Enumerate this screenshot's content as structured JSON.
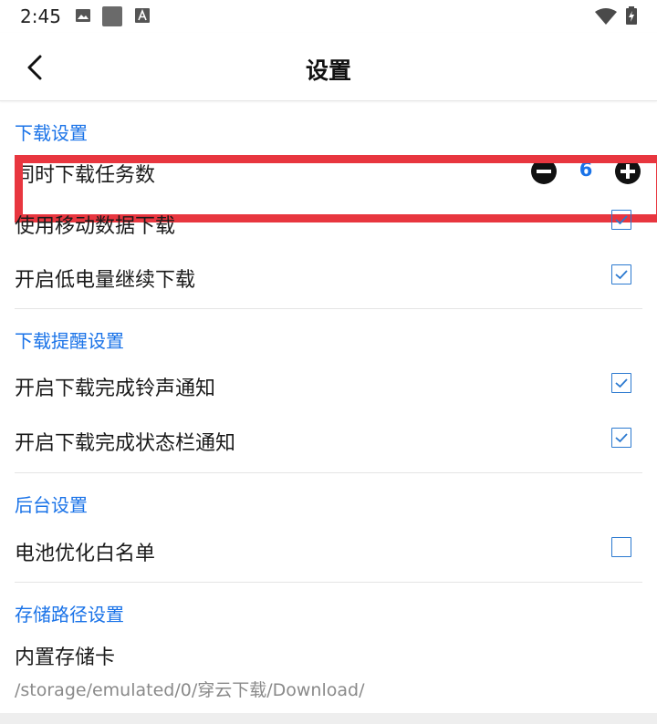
{
  "status_bar": {
    "time": "2:45",
    "icons": [
      "image-icon",
      "square-icon",
      "a-icon",
      "wifi-icon",
      "battery-charging-icon"
    ]
  },
  "app_bar": {
    "back_icon": "chevron-left-icon",
    "title": "设置"
  },
  "sections": {
    "download": {
      "title": "下载设置",
      "concurrent_tasks_label": "同时下载任务数",
      "concurrent_tasks_value": "6",
      "mobile_data_label": "使用移动数据下载",
      "mobile_data_checked": true,
      "low_battery_label": "开启低电量继续下载",
      "low_battery_checked": true
    },
    "reminder": {
      "title": "下载提醒设置",
      "ringtone_label": "开启下载完成铃声通知",
      "ringtone_checked": true,
      "statusbar_label": "开启下载完成状态栏通知",
      "statusbar_checked": true
    },
    "background": {
      "title": "后台设置",
      "battery_whitelist_label": "电池优化白名单",
      "battery_whitelist_checked": false
    },
    "storage": {
      "title": "存储路径设置",
      "internal_label": "内置存储卡",
      "path": "/storage/emulated/0/穿云下载/Download/"
    }
  },
  "colors": {
    "accent": "#1a73e8",
    "highlight": "#e8363f"
  }
}
